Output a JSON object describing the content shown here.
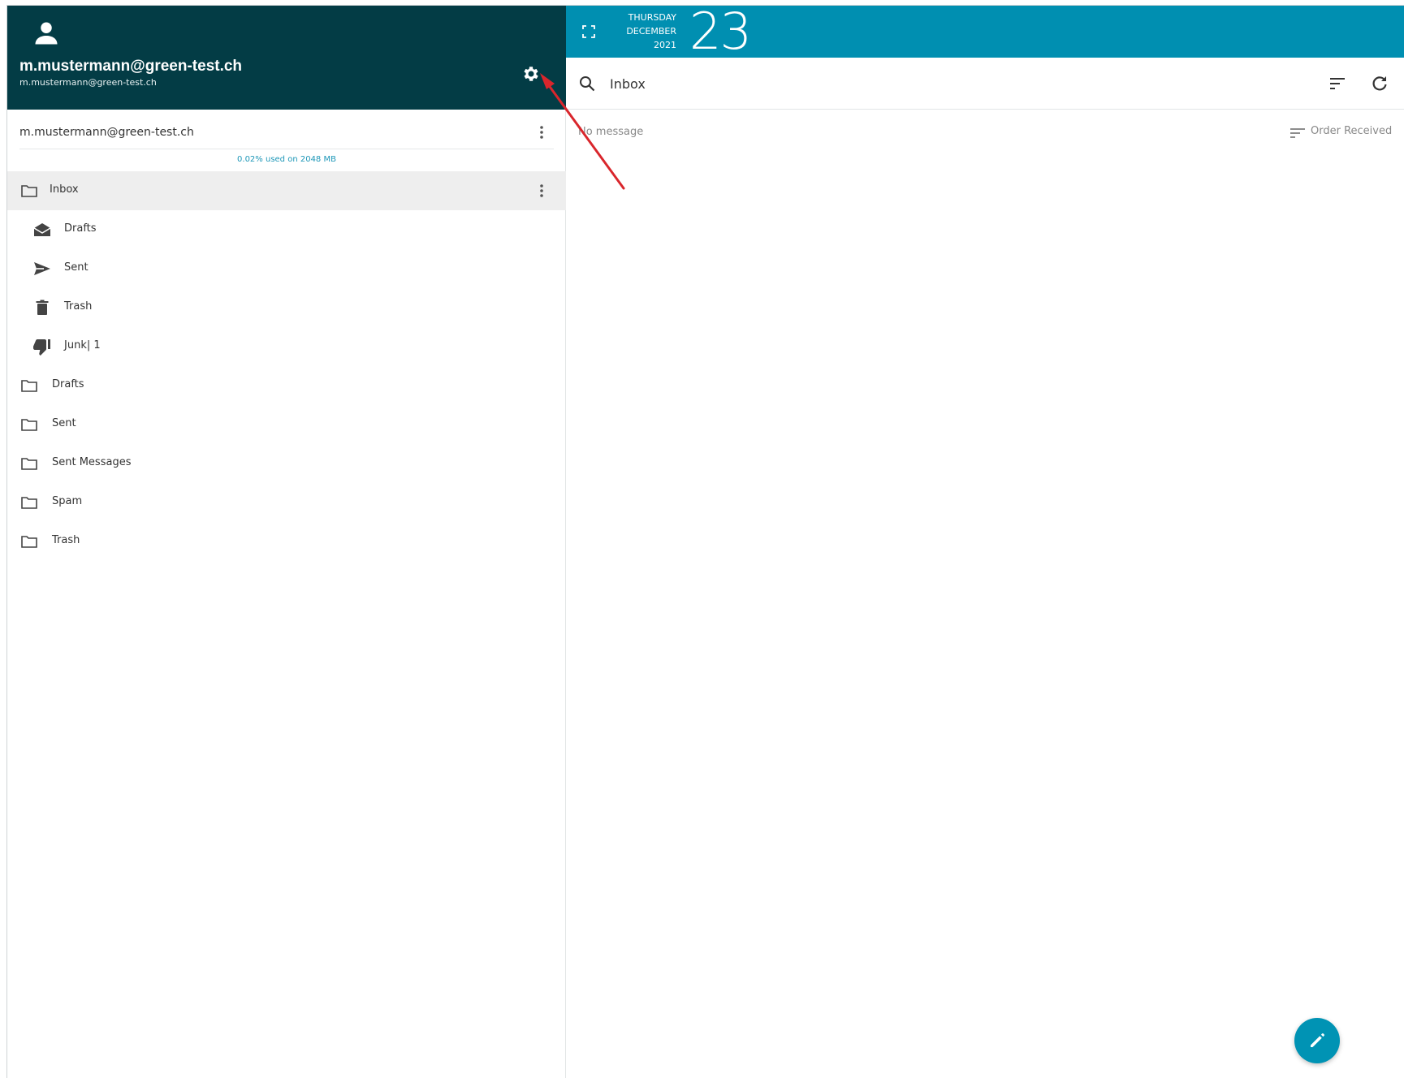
{
  "account": {
    "display_name": "m.mustermann@green-test.ch",
    "email": "m.mustermann@green-test.ch",
    "row_email": "m.mustermann@green-test.ch",
    "quota": "0.02% used on 2048 MB"
  },
  "folders": [
    {
      "label": "Inbox",
      "icon": "folder-icon",
      "active": true
    },
    {
      "label": "Drafts",
      "icon": "drafts-icon"
    },
    {
      "label": "Sent",
      "icon": "send-icon"
    },
    {
      "label": "Trash",
      "icon": "trash-icon"
    },
    {
      "label": "Junk| 1",
      "icon": "thumb-down-icon"
    },
    {
      "label": "Drafts",
      "icon": "folder-icon"
    },
    {
      "label": "Sent",
      "icon": "folder-icon"
    },
    {
      "label": "Sent Messages",
      "icon": "folder-icon"
    },
    {
      "label": "Spam",
      "icon": "folder-icon"
    },
    {
      "label": "Trash",
      "icon": "folder-icon"
    }
  ],
  "date": {
    "weekday": "THURSDAY",
    "month": "DECEMBER",
    "year": "2021",
    "day": "23"
  },
  "search": {
    "value": "Inbox",
    "placeholder": ""
  },
  "list": {
    "empty_text": "No message",
    "order_label": "Order Received"
  },
  "colors": {
    "header_bg": "#033c45",
    "topbar_bg": "#008fb1",
    "accent": "#0093b4",
    "annotation_arrow": "#d9262c"
  }
}
